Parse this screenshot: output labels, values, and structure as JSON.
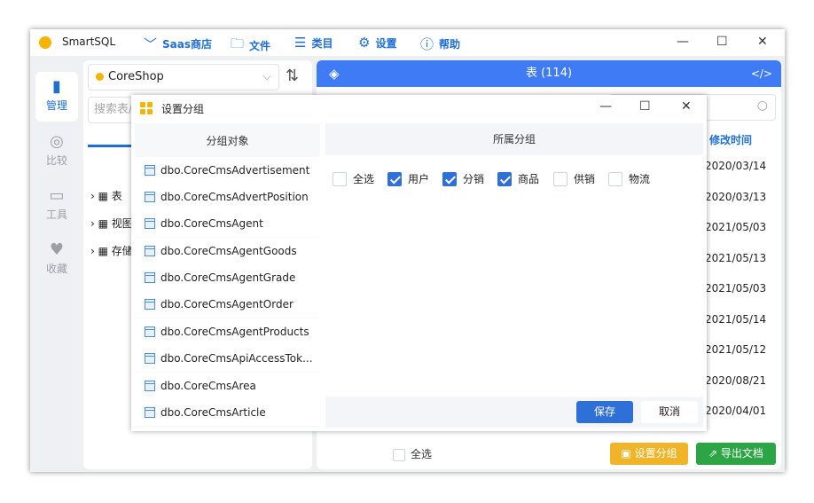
{
  "app": {
    "name": "SmartSQL"
  },
  "menu": [
    {
      "label": "Saas商店",
      "icon": "chevron-down-icon"
    },
    {
      "label": "文件",
      "icon": "folder-icon"
    },
    {
      "label": "类目",
      "icon": "list-icon"
    },
    {
      "label": "设置",
      "icon": "gear-icon"
    },
    {
      "label": "帮助",
      "icon": "info-icon"
    }
  ],
  "sidenav": [
    {
      "label": "管理",
      "icon": "book-icon",
      "active": true
    },
    {
      "label": "比较",
      "icon": "compass-icon"
    },
    {
      "label": "工具",
      "icon": "inbox-icon"
    },
    {
      "label": "收藏",
      "icon": "heart-icon"
    }
  ],
  "left": {
    "db": "CoreShop",
    "search_placeholder": "搜索表/",
    "tree": [
      "表",
      "视图",
      "存储"
    ]
  },
  "right": {
    "header": "表 (114)",
    "column_modified": "修改时间",
    "dates": [
      "2020/03/14",
      "2020/03/13",
      "2021/05/03",
      "2021/05/13",
      "2021/05/03",
      "2021/05/14",
      "2021/05/12",
      "2020/08/21",
      "2020/04/01"
    ],
    "select_all": "全选",
    "btn_group": "设置分组",
    "btn_export": "导出文档"
  },
  "dialog": {
    "title": "设置分组",
    "left_header": "分组对象",
    "right_header": "所属分组",
    "items": [
      "dbo.CoreCmsAdvertisement",
      "dbo.CoreCmsAdvertPosition",
      "dbo.CoreCmsAgent",
      "dbo.CoreCmsAgentGoods",
      "dbo.CoreCmsAgentGrade",
      "dbo.CoreCmsAgentOrder",
      "dbo.CoreCmsAgentProducts",
      "dbo.CoreCmsApiAccessTok...",
      "dbo.CoreCmsArea",
      "dbo.CoreCmsArticle"
    ],
    "groups": [
      {
        "label": "全选",
        "checked": false
      },
      {
        "label": "用户",
        "checked": true
      },
      {
        "label": "分销",
        "checked": true
      },
      {
        "label": "商品",
        "checked": true
      },
      {
        "label": "供销",
        "checked": false
      },
      {
        "label": "物流",
        "checked": false
      }
    ],
    "save": "保存",
    "cancel": "取消"
  }
}
